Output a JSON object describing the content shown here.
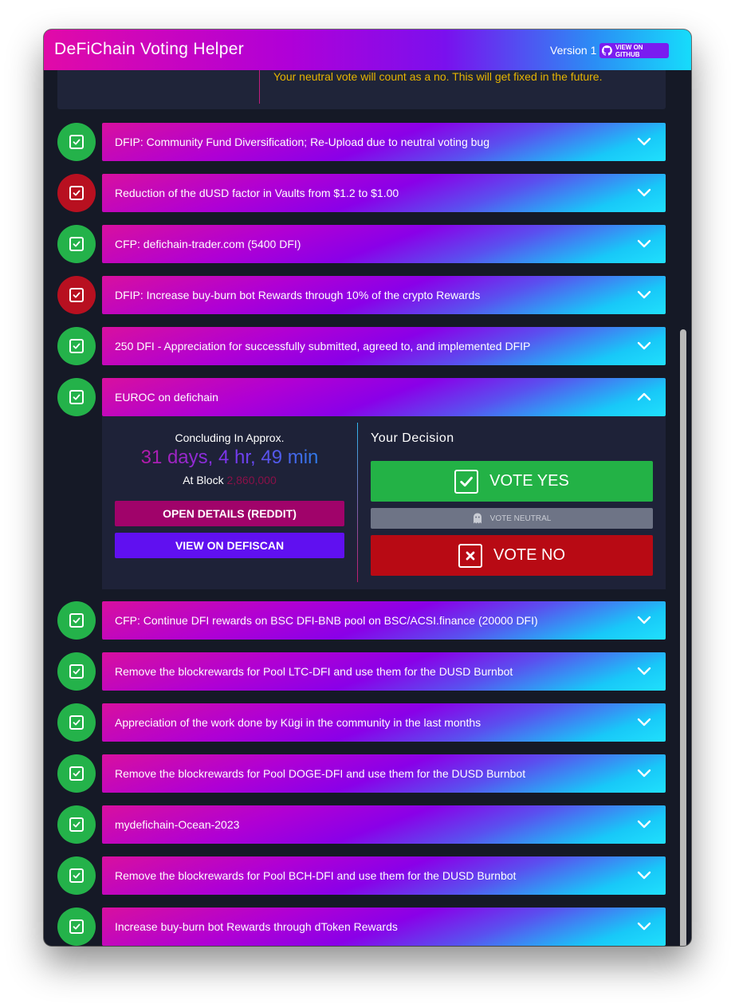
{
  "app": {
    "title": "DeFiChain Voting Helper",
    "version": "Version 1",
    "github_label": "VIEW ON GITHUB"
  },
  "notice": {
    "text": "Your neutral vote will count as a no. This will get fixed in the future."
  },
  "proposals": [
    {
      "title": "DFIP: Community Fund Diversification; Re-Upload due to neutral voting bug",
      "status": "yes",
      "expanded": false
    },
    {
      "title": "Reduction of the dUSD factor in Vaults from $1.2 to $1.00",
      "status": "no",
      "expanded": false
    },
    {
      "title": "CFP: defichain-trader.com (5400 DFI)",
      "status": "yes",
      "expanded": false
    },
    {
      "title": "DFIP: Increase buy-burn bot Rewards through 10% of the crypto Rewards",
      "status": "no",
      "expanded": false
    },
    {
      "title": "250 DFI - Appreciation for successfully submitted, agreed to, and implemented DFIP",
      "status": "yes",
      "expanded": false
    },
    {
      "title": "EUROC on defichain",
      "status": "yes",
      "expanded": true
    },
    {
      "title": "CFP: Continue DFI rewards on BSC DFI-BNB pool on BSC/ACSI.finance (20000 DFI)",
      "status": "yes",
      "expanded": false
    },
    {
      "title": "Remove the blockrewards for Pool LTC-DFI and use them for the DUSD Burnbot",
      "status": "yes",
      "expanded": false
    },
    {
      "title": "Appreciation of the work done by Kügi in the community in the last months",
      "status": "yes",
      "expanded": false
    },
    {
      "title": "Remove the blockrewards for Pool DOGE-DFI and use them for the DUSD Burnbot",
      "status": "yes",
      "expanded": false
    },
    {
      "title": "mydefichain-Ocean-2023",
      "status": "yes",
      "expanded": false
    },
    {
      "title": "Remove the blockrewards for Pool BCH-DFI and use them for the DUSD Burnbot",
      "status": "yes",
      "expanded": false
    },
    {
      "title": "Increase buy-burn bot Rewards through dToken Rewards",
      "status": "yes",
      "expanded": false
    }
  ],
  "details": {
    "concluding_label": "Concluding In Approx.",
    "countdown": "31 days, 4 hr, 49 min",
    "at_block_label": "At Block",
    "block": "2,860,000",
    "open_details_label": "OPEN DETAILS (REDDIT)",
    "defiscan_label": "VIEW ON DEFISCAN",
    "decision_title": "Your Decision",
    "vote_yes": "VOTE YES",
    "vote_neutral": "VOTE NEUTRAL",
    "vote_no": "VOTE NO"
  },
  "colors": {
    "accent_green": "#24b24a",
    "accent_red": "#b81020",
    "notice_text": "#e6b400",
    "background": "#151926"
  },
  "icons": {
    "github": "github-icon",
    "checked": "checkbox-checked-icon",
    "chevron_down": "chevron-down-icon",
    "chevron_up": "chevron-up-icon",
    "ghost": "ghost-icon",
    "x_box": "x-box-icon"
  }
}
